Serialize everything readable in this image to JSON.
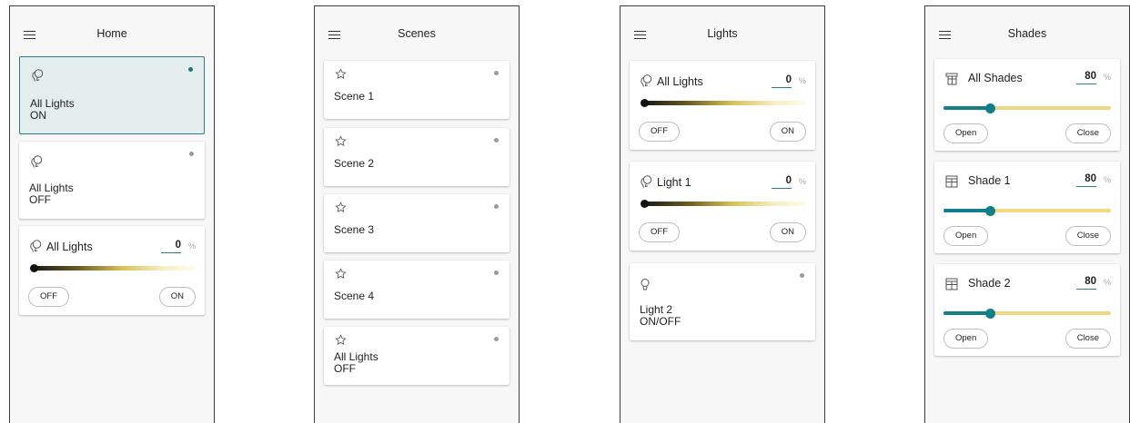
{
  "screens": {
    "home": {
      "title": "Home",
      "cards": [
        {
          "name": "All Lights",
          "state": "ON",
          "active": true
        },
        {
          "name": "All Lights",
          "state": "OFF",
          "active": false
        },
        {
          "name": "All Lights",
          "level": "0",
          "unit": "%",
          "off_label": "OFF",
          "on_label": "ON",
          "level_fraction": 0
        }
      ]
    },
    "scenes": {
      "title": "Scenes",
      "cards": [
        {
          "name": "Scene 1"
        },
        {
          "name": "Scene 2"
        },
        {
          "name": "Scene 3"
        },
        {
          "name": "Scene 4"
        },
        {
          "name": "All Lights",
          "state": "OFF"
        }
      ]
    },
    "lights": {
      "title": "Lights",
      "cards": [
        {
          "name": "All Lights",
          "level": "0",
          "unit": "%",
          "off_label": "OFF",
          "on_label": "ON",
          "level_fraction": 0
        },
        {
          "name": "Light 1",
          "level": "0",
          "unit": "%",
          "off_label": "OFF",
          "on_label": "ON",
          "level_fraction": 0
        },
        {
          "name": "Light 2",
          "state": "ON/OFF"
        }
      ]
    },
    "shades": {
      "title": "Shades",
      "cards": [
        {
          "name": "All Shades",
          "level": "80",
          "unit": "%",
          "open_label": "Open",
          "close_label": "Close",
          "position_fraction": 0.28
        },
        {
          "name": "Shade 1",
          "level": "80",
          "unit": "%",
          "open_label": "Open",
          "close_label": "Close",
          "position_fraction": 0.28
        },
        {
          "name": "Shade 2",
          "level": "80",
          "unit": "%",
          "open_label": "Open",
          "close_label": "Close",
          "position_fraction": 0.28
        }
      ]
    }
  },
  "icons": {
    "menu": "hamburger-menu-icon",
    "group_lights": "double-bulb-icon",
    "single_light": "bulb-icon",
    "scene": "star-outline-icon",
    "group_shades": "stacked-shade-icon",
    "single_shade": "shade-icon"
  },
  "colors": {
    "accent": "#17787f",
    "active_card_bg": "#e3edee",
    "inactive_dot": "#9a9a9a",
    "shade_track": "#f2d782"
  }
}
